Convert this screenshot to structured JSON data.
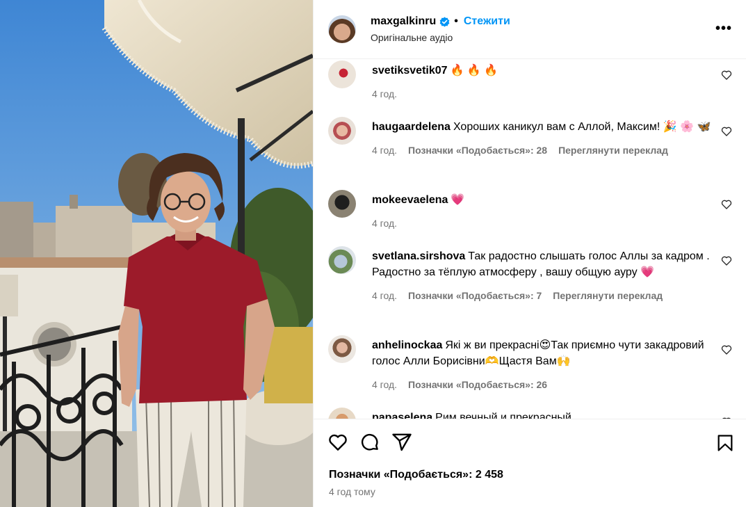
{
  "header": {
    "username": "maxgalkinru",
    "separator": "•",
    "follow_label": "Стежити",
    "audio_label": "Оригінальне аудіо",
    "more_label": "•••"
  },
  "comments": [
    {
      "user": "svetiksvetik07",
      "text": "🔥 🔥 🔥",
      "time": "4 год.",
      "likes": "",
      "translate": ""
    },
    {
      "user": "haugaardelena",
      "text": "Хороших каникул вам с Аллой, Максим! 🎉 🌸 🦋",
      "time": "4 год.",
      "likes": "Позначки «Подобається»: 28",
      "translate": "Переглянути переклад"
    },
    {
      "user": "mokeevaelena",
      "text": "💗",
      "time": "4 год.",
      "likes": "",
      "translate": ""
    },
    {
      "user": "svetlana.sirshova",
      "text": "Так радостно слышать голос Аллы за кадром . Радостно за тёплую атмосферу , вашу общую ауру 💗",
      "time": "4 год.",
      "likes": "Позначки «Подобається»: 7",
      "translate": "Переглянути переклад"
    },
    {
      "user": "anhelinockaa",
      "text": "Які ж ви прекрасні😍Так приємно чути закадровий голос Алли Борисівни🫶Щастя Вам🙌",
      "time": "4 год.",
      "likes": "Позначки «Подобається»: 26",
      "translate": ""
    },
    {
      "user": "papaselena",
      "text": "Рим вечный и прекрасный",
      "time": "",
      "likes": "",
      "translate": ""
    }
  ],
  "footer": {
    "likes_text": "Позначки «Подобається»: 2 458",
    "time_text": "4 год тому"
  },
  "colors": {
    "accent": "#0095f6",
    "muted": "#737373",
    "verified": "#0095f6"
  },
  "icons": {
    "like": "heart-icon",
    "comment": "comment-bubble-icon",
    "share": "paper-plane-icon",
    "save": "bookmark-icon",
    "more": "ellipsis-icon",
    "verified": "verified-badge-icon"
  }
}
